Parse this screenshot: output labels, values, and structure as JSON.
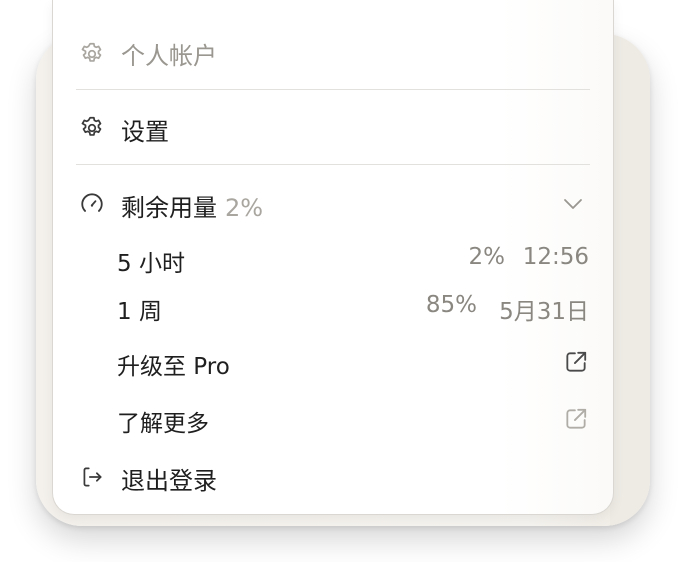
{
  "menu": {
    "account_label": "个人帐户",
    "settings_label": "设置",
    "usage": {
      "label": "剩余用量",
      "percent": "2%"
    },
    "limits": [
      {
        "label": "5 小时",
        "percent": "2%",
        "reset": "12:56"
      },
      {
        "label": "1 周",
        "percent": "85%",
        "reset": "5月31日"
      }
    ],
    "upgrade_label": "升级至 Pro",
    "learn_more_label": "了解更多",
    "logout_label": "退出登录"
  },
  "icons": {
    "account": "gear-icon",
    "settings": "gear-icon",
    "usage": "gauge-icon",
    "usage_toggle": "chevron-down-icon",
    "upgrade": "external-link-icon",
    "learn_more": "external-link-icon",
    "logout": "logout-icon"
  }
}
